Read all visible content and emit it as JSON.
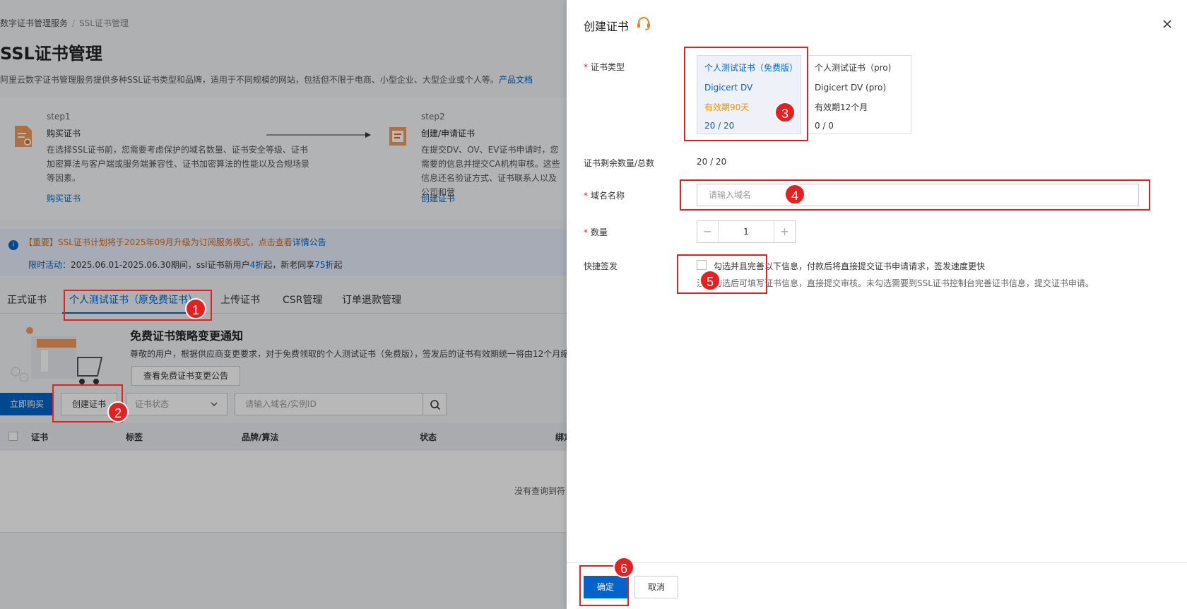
{
  "background": {
    "breadcrumb": {
      "parent": "数字证书管理服务",
      "current": "SSL证书管理"
    },
    "title": "SSL证书管理",
    "description": "阿里云数字证书管理服务提供多种SSL证书类型和品牌，适用于不同规模的网站，包括但不限于电商、小型企业、大型企业或个人等。",
    "doc_link": "产品文档",
    "steps": [
      {
        "no": "step1",
        "name": "购买证书",
        "text": "在选择SSL证书前，您需要考虑保护的域名数量、证书安全等级、证书加密算法与客户端或服务端兼容性、证书加密算法的性能以及合规场景等因素。",
        "link": "购买证书"
      },
      {
        "no": "step2",
        "name": "创建/申请证书",
        "text": "在提交DV、OV、EV证书申请时，您需要的信息并提交CA机构审核。这些信息还名验证方式、证书联系人以及公司和营",
        "link": "创建证书"
      }
    ],
    "notice": {
      "important": "【重要】SSL证书计划将于2025年09月升级为订阅服务模式，点击查看",
      "detail_link": "详情公告",
      "promo_prefix": "限时活动：",
      "promo_text": "2025.06.01-2025.06.30期间，ssl证书新用户",
      "promo_discount1": "4折",
      "promo_mid": "起，新老同享",
      "promo_discount2": "75折",
      "promo_suffix": "起"
    },
    "tabs": [
      "正式证书",
      "个人测试证书（原免费证书）",
      "上传证书",
      "CSR管理",
      "订单退款管理"
    ],
    "promo": {
      "title": "免费证书策略变更通知",
      "text": "尊敬的用户，根据供应商变更要求，对于免费领取的个人测试证书（免费版），签发后的证书有效期统一将由12个月缩",
      "button": "查看免费证书变更公告"
    },
    "toolbar": {
      "buy": "立即购买",
      "create": "创建证书",
      "status_placeholder": "证书状态",
      "search_placeholder": "请输入域名/实例ID"
    },
    "table": {
      "columns": [
        "证书",
        "标签",
        "品牌/算法",
        "状态",
        "绑定"
      ],
      "empty": "没有查询到符"
    }
  },
  "drawer": {
    "title": "创建证书",
    "labels": {
      "cert_type": "证书类型",
      "remain": "证书剩余数量/总数",
      "domain": "域名名称",
      "quantity": "数量",
      "quick": "快捷签发"
    },
    "type_cards": [
      {
        "name": "个人测试证书（免费版）",
        "brand": "Digicert DV",
        "validity": "有效期90天",
        "count": "20 / 20",
        "selected": true
      },
      {
        "name": "个人测试证书（pro)",
        "brand": "Digicert DV (pro)",
        "validity": "有效期12个月",
        "count": "0 / 0",
        "selected": false
      }
    ],
    "remain_value": "20 / 20",
    "domain_placeholder": "请输入域名",
    "quantity": {
      "minus": "−",
      "value": "1",
      "plus": "+"
    },
    "quick_text": "勾选并且完善以下信息，付款后将直接提交证书申请请求，签发速度更快",
    "quick_sub": "注：勾选后可填写证书信息，直接提交审核。未勾选需要到SSL证书控制台完善证书信息，提交证书申请。",
    "ok": "确定",
    "cancel": "取消"
  },
  "annotations": [
    "1",
    "2",
    "3",
    "4",
    "5",
    "6"
  ],
  "colors": {
    "primary": "#0064c8",
    "highlight": "#e62020",
    "orange": "#e8940a"
  }
}
